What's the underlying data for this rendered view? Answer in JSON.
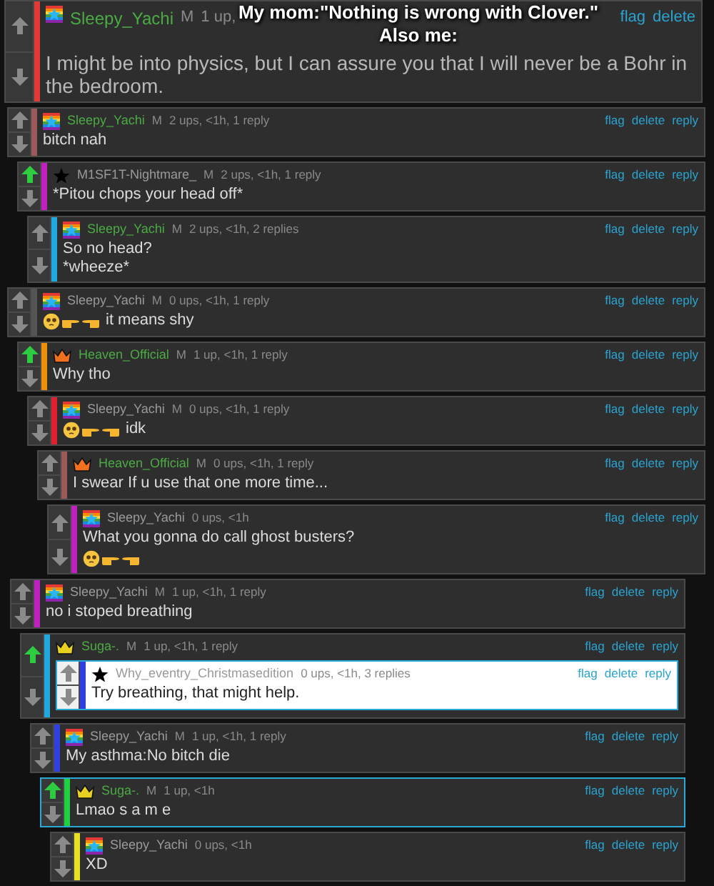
{
  "caption": [
    "My mom:\"Nothing is wrong with Clover.\"",
    "Also me:"
  ],
  "screenshots": [
    {
      "comments": [
        {
          "user": "Sleepy_Yachi",
          "name_highlighted": true,
          "badge": {
            "kind": "rainbow"
          },
          "mod_mark": "M",
          "meta": "1 up,",
          "color": "#e53935",
          "upvoted": false,
          "highlighted": false,
          "kind": "large",
          "actions": [
            "flag",
            "delete"
          ],
          "lines": [
            {
              "kind": "text",
              "text": "I might be into physics, but I can assure you that I will never be a Bohr in the bedroom."
            }
          ]
        }
      ]
    },
    {
      "comments": [
        {
          "user": "Sleepy_Yachi",
          "name_highlighted": true,
          "badge": {
            "kind": "rainbow"
          },
          "mod_mark": "M",
          "meta": "2 ups, <1h, 1 reply",
          "color": "#9b5a5a",
          "upvoted": false,
          "highlighted": false,
          "kind": "normal",
          "actions": [
            "flag",
            "delete",
            "reply"
          ],
          "lines": [
            {
              "kind": "text",
              "text": "bitch nah"
            }
          ]
        }
      ]
    },
    {
      "comments": [
        {
          "user": "M1SF1T-Nightmare_",
          "name_highlighted": false,
          "badge": {
            "kind": "star"
          },
          "mod_mark": "M",
          "meta": "2 ups, <1h, 1 reply",
          "color": "#c020c0",
          "upvoted": true,
          "highlighted": false,
          "kind": "normal",
          "actions": [
            "flag",
            "delete",
            "reply"
          ],
          "lines": [
            {
              "kind": "text",
              "text": "*Pitou chops your head off*"
            }
          ],
          "children": [
            {
              "user": "Sleepy_Yachi",
              "name_highlighted": true,
              "badge": {
                "kind": "rainbow"
              },
              "mod_mark": "M",
              "meta": "2 ups, <1h, 2 replies",
              "color": "#20a8e0",
              "upvoted": false,
              "highlighted": false,
              "kind": "normal",
              "actions": [
                "flag",
                "delete",
                "reply"
              ],
              "lines": [
                {
                  "kind": "text",
                  "text": "So no head?"
                },
                {
                  "kind": "text",
                  "text": "*wheeze*"
                }
              ]
            }
          ]
        }
      ]
    },
    {
      "comments": [
        {
          "user": "Sleepy_Yachi",
          "name_highlighted": false,
          "badge": {
            "kind": "rainbow"
          },
          "mod_mark": "M",
          "meta": "0 ups, <1h, 1 reply",
          "color": "#555555",
          "upvoted": false,
          "highlighted": false,
          "kind": "normal",
          "actions": [
            "flag",
            "delete",
            "reply"
          ],
          "lines": [
            {
              "kind": "emoji_text",
              "text": "it means shy"
            }
          ]
        }
      ]
    },
    {
      "comments": [
        {
          "user": "Heaven_Official",
          "name_highlighted": true,
          "badge": {
            "kind": "crown",
            "color": "#f07020"
          },
          "mod_mark": "M",
          "meta": "1 up, <1h, 1 reply",
          "color": "#f0900a",
          "upvoted": true,
          "highlighted": false,
          "kind": "normal",
          "actions": [
            "flag",
            "delete",
            "reply"
          ],
          "lines": [
            {
              "kind": "text",
              "text": "Why tho"
            }
          ],
          "children": [
            {
              "user": "Sleepy_Yachi",
              "name_highlighted": false,
              "badge": {
                "kind": "rainbow"
              },
              "mod_mark": "M",
              "meta": "0 ups, <1h, 1 reply",
              "color": "#e02030",
              "upvoted": false,
              "highlighted": false,
              "kind": "normal",
              "actions": [
                "flag",
                "delete",
                "reply"
              ],
              "lines": [
                {
                  "kind": "emoji_text",
                  "text": "idk"
                }
              ],
              "children": [
                {
                  "user": "Heaven_Official",
                  "name_highlighted": true,
                  "badge": {
                    "kind": "crown",
                    "color": "#f07020"
                  },
                  "mod_mark": "M",
                  "meta": "0 ups, <1h, 1 reply",
                  "color": "#9b5a5a",
                  "upvoted": false,
                  "highlighted": false,
                  "kind": "normal",
                  "actions": [
                    "flag",
                    "delete",
                    "reply"
                  ],
                  "lines": [
                    {
                      "kind": "text",
                      "text": "I swear If u use that one more time..."
                    }
                  ],
                  "children": [
                    {
                      "user": "Sleepy_Yachi",
                      "name_highlighted": false,
                      "badge": {
                        "kind": "rainbow"
                      },
                      "meta": "0 ups, <1h",
                      "color": "#c020c0",
                      "upvoted": false,
                      "highlighted": false,
                      "kind": "normal",
                      "actions": [
                        "flag",
                        "delete",
                        "reply"
                      ],
                      "lines": [
                        {
                          "kind": "text",
                          "text": "What you gonna do call ghost busters?"
                        },
                        {
                          "kind": "emoji"
                        }
                      ]
                    }
                  ]
                }
              ]
            }
          ]
        }
      ]
    },
    {
      "comments": [
        {
          "user": "Sleepy_Yachi",
          "name_highlighted": false,
          "badge": {
            "kind": "rainbow"
          },
          "mod_mark": "M",
          "meta": "1 up, <1h, 1 reply",
          "color": "#c020c0",
          "upvoted": false,
          "highlighted": false,
          "kind": "normal",
          "actions": [
            "flag",
            "delete",
            "reply"
          ],
          "lines": [
            {
              "kind": "text",
              "text": "no i stoped breathing"
            }
          ],
          "children": [
            {
              "user": "Suga-.",
              "name_highlighted": true,
              "badge": {
                "kind": "crown",
                "color": "#e8d020"
              },
              "mod_mark": "M",
              "meta": "1 up, <1h, 1 reply",
              "color": "#20a8e0",
              "upvoted": true,
              "highlighted": false,
              "kind": "normal",
              "actions": [
                "flag",
                "delete",
                "reply"
              ],
              "children": [
                {
                  "user": "Why_eventry_Christmasedition",
                  "name_highlighted": false,
                  "badge": {
                    "kind": "star"
                  },
                  "meta": "0 ups, <1h, 3 replies",
                  "color": "#3040e0",
                  "upvoted": false,
                  "highlighted": true,
                  "kind": "embedded",
                  "actions": [
                    "flag",
                    "delete",
                    "reply"
                  ],
                  "lines": [
                    {
                      "kind": "text",
                      "text": "Try breathing, that might help."
                    }
                  ]
                },
                {
                  "user": "Sleepy_Yachi",
                  "name_highlighted": false,
                  "badge": {
                    "kind": "rainbow"
                  },
                  "mod_mark": "M",
                  "meta": "1 up, <1h, 1 reply",
                  "color": "#3040e0",
                  "upvoted": false,
                  "highlighted": false,
                  "kind": "normal",
                  "actions": [
                    "flag",
                    "delete",
                    "reply"
                  ],
                  "lines": [
                    {
                      "kind": "text",
                      "text": "My asthma:No bitch die"
                    }
                  ],
                  "children": [
                    {
                      "user": "Suga-.",
                      "name_highlighted": true,
                      "badge": {
                        "kind": "crown",
                        "color": "#e8d020"
                      },
                      "mod_mark": "M",
                      "meta": "1 up, <1h",
                      "color": "#20d040",
                      "upvoted": true,
                      "highlighted": true,
                      "kind": "normal",
                      "actions": [
                        "flag",
                        "delete",
                        "reply"
                      ],
                      "lines": [
                        {
                          "kind": "text",
                          "text": "Lmao s a m e"
                        }
                      ],
                      "children": [
                        {
                          "user": "Sleepy_Yachi",
                          "name_highlighted": false,
                          "badge": {
                            "kind": "rainbow"
                          },
                          "meta": "0 ups, <1h",
                          "color": "#e8e020",
                          "upvoted": false,
                          "highlighted": false,
                          "kind": "normal",
                          "actions": [
                            "flag",
                            "delete",
                            "reply"
                          ],
                          "lines": [
                            {
                              "kind": "text",
                              "text": "XD"
                            }
                          ]
                        }
                      ]
                    }
                  ]
                }
              ]
            }
          ]
        }
      ]
    }
  ]
}
